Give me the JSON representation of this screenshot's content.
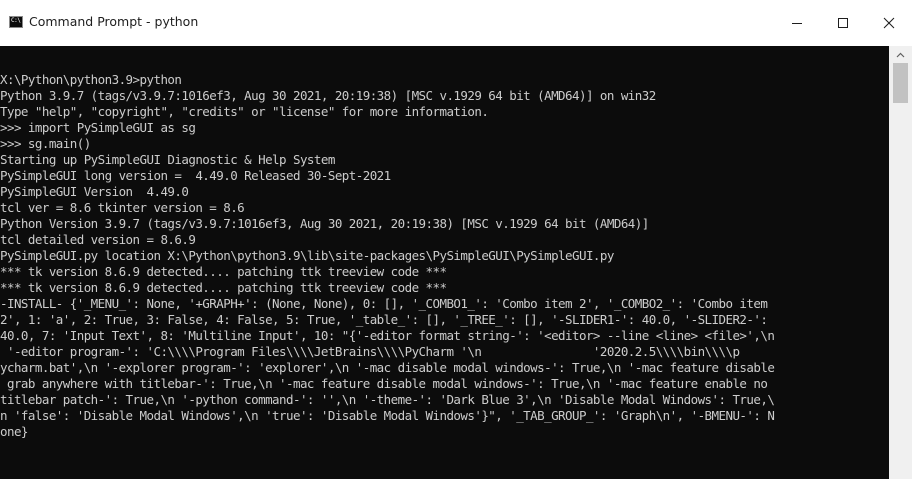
{
  "window": {
    "title": "Command Prompt - python",
    "icon_text": "C:\\"
  },
  "console": {
    "lines": [
      "",
      "X:\\Python\\python3.9>python",
      "Python 3.9.7 (tags/v3.9.7:1016ef3, Aug 30 2021, 20:19:38) [MSC v.1929 64 bit (AMD64)] on win32",
      "Type \"help\", \"copyright\", \"credits\" or \"license\" for more information.",
      ">>> import PySimpleGUI as sg",
      ">>> sg.main()",
      "Starting up PySimpleGUI Diagnostic & Help System",
      "PySimpleGUI long version =  4.49.0 Released 30-Sept-2021",
      "PySimpleGUI Version  4.49.0",
      "tcl ver = 8.6 tkinter version = 8.6",
      "Python Version 3.9.7 (tags/v3.9.7:1016ef3, Aug 30 2021, 20:19:38) [MSC v.1929 64 bit (AMD64)]",
      "tcl detailed version = 8.6.9",
      "PySimpleGUI.py location X:\\Python\\python3.9\\lib\\site-packages\\PySimpleGUI\\PySimpleGUI.py",
      "*** tk version 8.6.9 detected.... patching ttk treeview code ***",
      "*** tk version 8.6.9 detected.... patching ttk treeview code ***",
      "-INSTALL- {'_MENU_': None, '+GRAPH+': (None, None), 0: [], '_COMBO1_': 'Combo item 2', '_COMBO2_': 'Combo item",
      "2', 1: 'a', 2: True, 3: False, 4: False, 5: True, '_table_': [], '_TREE_': [], '-SLIDER1-': 40.0, '-SLIDER2-':",
      "40.0, 7: 'Input Text', 8: 'Multiline Input', 10: \"{'-editor format string-': '<editor> --line <line> <file>',\\n",
      " '-editor program-': 'C:\\\\\\\\Program Files\\\\\\\\JetBrains\\\\\\\\PyCharm '\\n                '2020.2.5\\\\\\\\bin\\\\\\\\p",
      "ycharm.bat',\\n '-explorer program-': 'explorer',\\n '-mac disable modal windows-': True,\\n '-mac feature disable",
      " grab anywhere with titlebar-': True,\\n '-mac feature disable modal windows-': True,\\n '-mac feature enable no",
      "titlebar patch-': True,\\n '-python command-': '',\\n '-theme-': 'Dark Blue 3',\\n 'Disable Modal Windows': True,\\",
      "n 'false': 'Disable Modal Windows',\\n 'true': 'Disable Modal Windows'}\", '_TAB_GROUP_': 'Graph\\n', '-BMENU-': N",
      "one}"
    ]
  },
  "colors": {
    "console_bg": "#0c0c0c",
    "console_fg": "#cccccc",
    "titlebar_bg": "#ffffff"
  },
  "icons": {
    "app": "command-prompt-icon",
    "minimize": "minimize-icon",
    "maximize": "maximize-icon",
    "close": "close-icon",
    "scroll_up": "chevron-up-icon"
  }
}
